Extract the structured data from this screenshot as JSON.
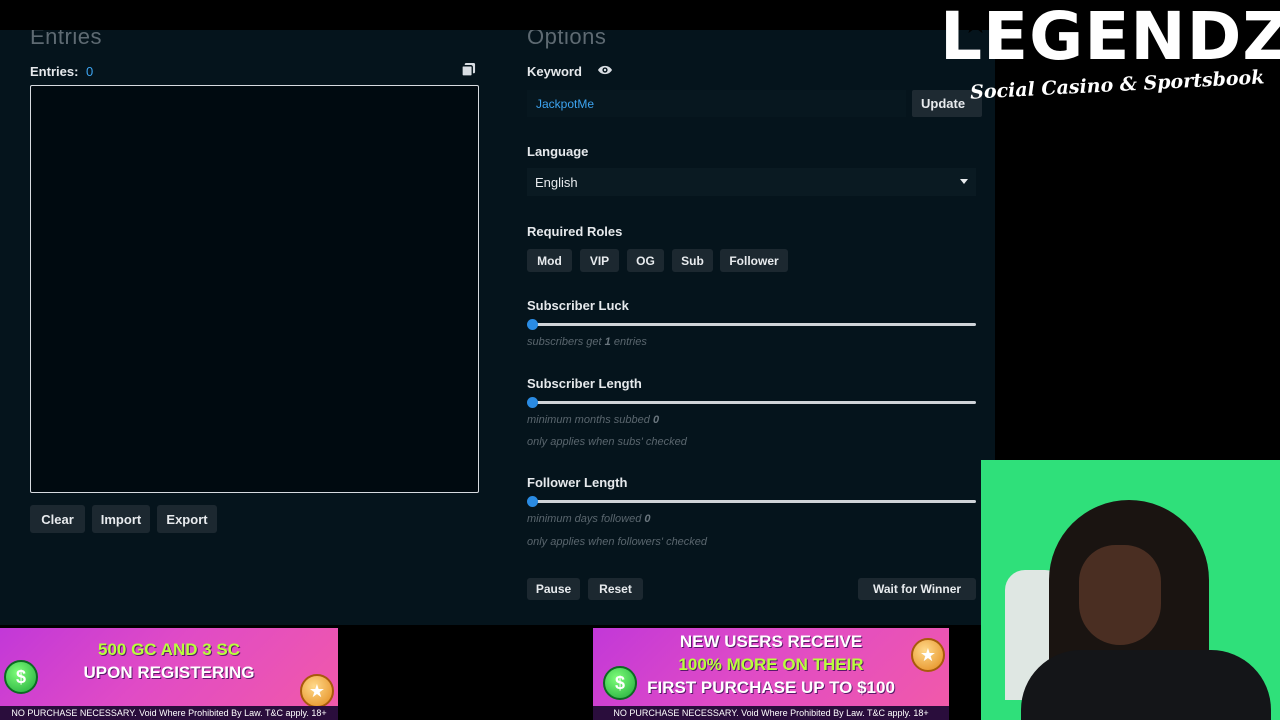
{
  "entries_panel": {
    "title": "Entries",
    "entries_label": "Entries:",
    "entries_count": "0",
    "buttons": {
      "clear": "Clear",
      "import": "Import",
      "export": "Export"
    }
  },
  "options_panel": {
    "title": "Options",
    "keyword": {
      "label": "Keyword",
      "value": "JackpotMe",
      "update_button": "Update"
    },
    "language": {
      "label": "Language",
      "selected": "English"
    },
    "required_roles": {
      "label": "Required Roles",
      "roles": [
        "Mod",
        "VIP",
        "OG",
        "Sub",
        "Follower"
      ]
    },
    "subscriber_luck": {
      "label": "Subscriber Luck",
      "hint_prefix": "subscribers get",
      "value": "1",
      "hint_suffix": "entries",
      "level": 0
    },
    "subscriber_length": {
      "label": "Subscriber Length",
      "hint_prefix": "minimum months subbed",
      "value": "0",
      "note": "only applies when subs' checked",
      "level": 0
    },
    "follower_length": {
      "label": "Follower Length",
      "hint_prefix": "minimum days followed",
      "value": "0",
      "note": "only applies when followers' checked",
      "level": 0
    },
    "actions": {
      "pause": "Pause",
      "reset": "Reset",
      "wait": "Wait for Winner"
    }
  },
  "overlay": {
    "logo_title": "LEGENDZ",
    "logo_tagline": "Social Casino & Sportsbook",
    "banner_left": {
      "line1": "500 GC AND 3 SC",
      "line2": "UPON REGISTERING",
      "footer": "NO PURCHASE NECESSARY. Void Where Prohibited By Law. T&C apply. 18+"
    },
    "banner_right": {
      "line1": "NEW USERS RECEIVE",
      "line2": "100% MORE ON THEIR",
      "line3": "FIRST PURCHASE UP TO $100",
      "footer": "NO PURCHASE NECESSARY. Void Where Prohibited By Law. T&C apply. 18+"
    }
  },
  "colors": {
    "accent": "#2a8be3",
    "keyword_text": "#3da4f0",
    "panel_bg": "#05141c",
    "webcam_bg": "#2fe07a",
    "banner": "#d548d0"
  }
}
